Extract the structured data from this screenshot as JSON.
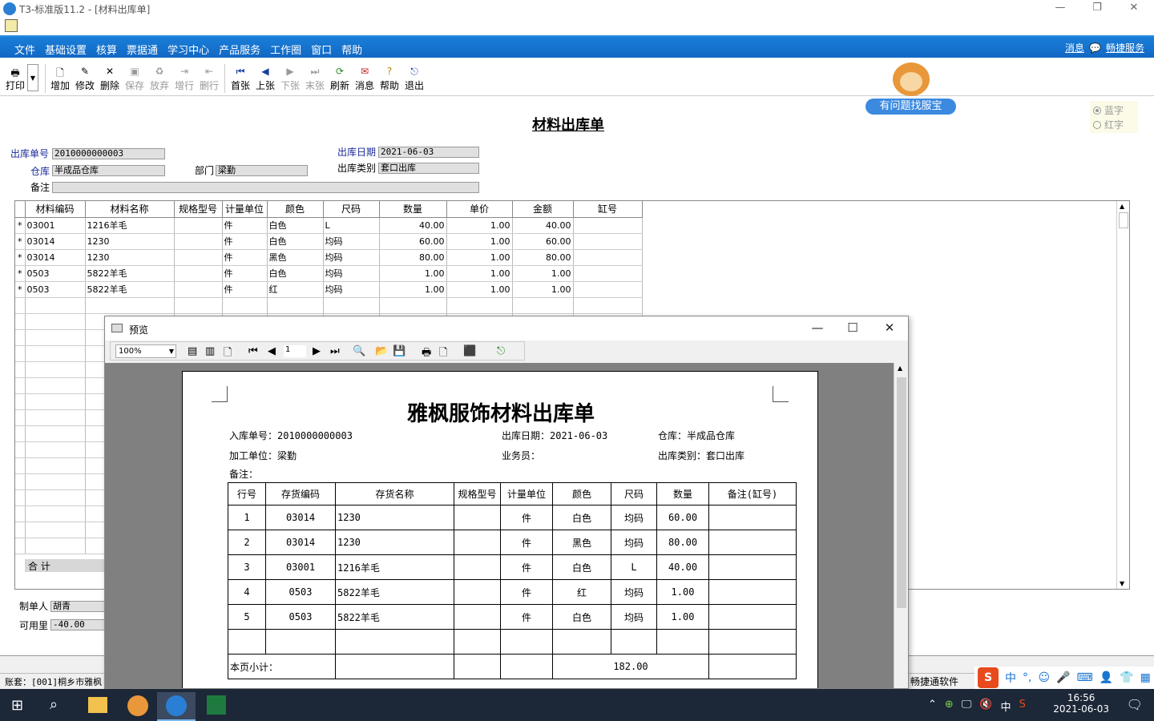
{
  "window": {
    "title": "T3-标准版11.2 - [材料出库单]"
  },
  "menu": {
    "items": [
      "文件",
      "基础设置",
      "核算",
      "票据通",
      "学习中心",
      "产品服务",
      "工作圈",
      "窗口",
      "帮助"
    ],
    "right_messages": "消息",
    "right_service": "畅捷服务"
  },
  "toolbar": {
    "print": "打印",
    "add": "增加",
    "edit": "修改",
    "delete": "删除",
    "save": "保存",
    "discard": "放弃",
    "add_row": "增行",
    "del_row": "删行",
    "first": "首张",
    "prev": "上张",
    "next": "下张",
    "last": "末张",
    "refresh": "刷新",
    "message": "消息",
    "help": "帮助",
    "exit": "退出"
  },
  "mascot": {
    "label": "有问题找服宝"
  },
  "form": {
    "title": "材料出库单",
    "radio_blue": "蓝字",
    "radio_red": "红字",
    "doc_no_label": "出库单号",
    "doc_no": "2010000000003",
    "date_label": "出库日期",
    "date": "2021-06-03",
    "warehouse_label": "仓库",
    "warehouse": "半成品仓库",
    "dept_label": "部门",
    "dept": "梁勤",
    "type_label": "出库类别",
    "type": "套口出库",
    "note_label": "备注",
    "note": ""
  },
  "grid": {
    "headers": [
      "材料编码",
      "材料名称",
      "规格型号",
      "计量单位",
      "颜色",
      "尺码",
      "数量",
      "单价",
      "金额",
      "缸号"
    ],
    "rows": [
      [
        "03001",
        "1216羊毛",
        "",
        "件",
        "白色",
        "L",
        "40.00",
        "1.00",
        "40.00",
        ""
      ],
      [
        "03014",
        "1230",
        "",
        "件",
        "白色",
        "均码",
        "60.00",
        "1.00",
        "60.00",
        ""
      ],
      [
        "03014",
        "1230",
        "",
        "件",
        "黑色",
        "均码",
        "80.00",
        "1.00",
        "80.00",
        ""
      ],
      [
        "0503",
        "5822羊毛",
        "",
        "件",
        "白色",
        "均码",
        "1.00",
        "1.00",
        "1.00",
        ""
      ],
      [
        "0503",
        "5822羊毛",
        "",
        "件",
        "红",
        "均码",
        "1.00",
        "1.00",
        "1.00",
        ""
      ]
    ],
    "sum_label": "合 计",
    "row_marker": "*"
  },
  "footer": {
    "maker_label": "制单人",
    "maker": "胡青",
    "avail_label": "可用里",
    "avail": "-40.00",
    "account": "账套：[001]桐乡市雅枫",
    "right_text": "畅捷通软件"
  },
  "preview": {
    "title": "预览",
    "zoom": "100%",
    "page": "1",
    "report_title": "雅枫服饰材料出库单",
    "in_no": "入库单号：2010000000003",
    "out_date": "出库日期：2021-06-03",
    "warehouse": "仓库：半成品仓库",
    "processor": "加工单位：梁勤",
    "clerk": "业务员：",
    "out_type": "出库类别：套口出库",
    "note": "备注：",
    "headers": [
      "行号",
      "存货编码",
      "存货名称",
      "规格型号",
      "计量单位",
      "颜色",
      "尺码",
      "数量",
      "备注(缸号)"
    ],
    "rows": [
      [
        "1",
        "03014",
        "1230",
        "",
        "件",
        "白色",
        "均码",
        "60.00",
        ""
      ],
      [
        "2",
        "03014",
        "1230",
        "",
        "件",
        "黑色",
        "均码",
        "80.00",
        ""
      ],
      [
        "3",
        "03001",
        "1216羊毛",
        "",
        "件",
        "白色",
        "L",
        "40.00",
        ""
      ],
      [
        "4",
        "0503",
        "5822羊毛",
        "",
        "件",
        "红",
        "均码",
        "1.00",
        ""
      ],
      [
        "5",
        "0503",
        "5822羊毛",
        "",
        "件",
        "白色",
        "均码",
        "1.00",
        ""
      ]
    ],
    "subtotal_label": "本页小计：",
    "subtotal": "182.00"
  },
  "ime": {
    "lang": "中"
  },
  "taskbar": {
    "time": "16:56",
    "date": "2021-06-03",
    "tray_lang": "中"
  },
  "colors": {
    "menu_blue": "#1a7ed8",
    "mascot_btn": "#3c8ae0",
    "taskbar": "#1c2738"
  }
}
